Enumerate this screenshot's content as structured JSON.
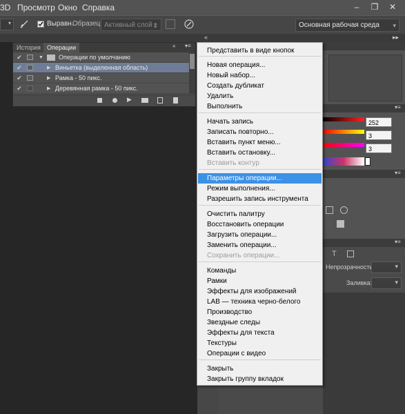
{
  "menubar": {
    "items": [
      "3D",
      "Просмотр",
      "Окно",
      "Справка"
    ]
  },
  "window_controls": [
    "–",
    "❐",
    "✕"
  ],
  "options_bar": {
    "align_label": "Выравн.",
    "sample_label": "Образец:",
    "sample_value": "Активный слой",
    "workspace_value": "Основная рабочая среда"
  },
  "panel": {
    "tabs": [
      "История",
      "Операции"
    ],
    "set_name": "Операции по умолчанию",
    "rows": [
      {
        "label": "Виньетка (выделенная область)",
        "selected": true
      },
      {
        "label": "Рамка - 50 пикс.",
        "selected": false
      },
      {
        "label": "Деревянная рамка - 50 пикс.",
        "selected": false
      }
    ],
    "collapse_glyph": "«",
    "menu_glyph": "▾≡"
  },
  "color_panel": {
    "values": [
      "252",
      "3",
      "3"
    ]
  },
  "layers_panel": {
    "opacity_label": "Непрозрачность:",
    "fill_label": "Заливка:"
  },
  "menu": {
    "groups": [
      [
        {
          "label": "Представить в виде кнопок"
        }
      ],
      [
        {
          "label": "Новая операция..."
        },
        {
          "label": "Новый набор..."
        },
        {
          "label": "Создать дубликат"
        },
        {
          "label": "Удалить"
        },
        {
          "label": "Выполнить"
        }
      ],
      [
        {
          "label": "Начать запись"
        },
        {
          "label": "Записать повторно..."
        },
        {
          "label": "Вставить пункт меню..."
        },
        {
          "label": "Вставить остановку..."
        },
        {
          "label": "Вставить контур",
          "disabled": true
        }
      ],
      [
        {
          "label": "Параметры операции...",
          "highlighted": true
        },
        {
          "label": "Режим выполнения..."
        },
        {
          "label": "Разрешить запись инструмента"
        }
      ],
      [
        {
          "label": "Очистить палитру"
        },
        {
          "label": "Восстановить операции"
        },
        {
          "label": "Загрузить операции..."
        },
        {
          "label": "Заменить операции..."
        },
        {
          "label": "Сохранить операции...",
          "disabled": true
        }
      ],
      [
        {
          "label": "Команды"
        },
        {
          "label": "Рамки"
        },
        {
          "label": "Эффекты для изображений"
        },
        {
          "label": "LAB — техника черно-белого"
        },
        {
          "label": "Производство"
        },
        {
          "label": "Звездные следы"
        },
        {
          "label": "Эффекты для текста"
        },
        {
          "label": "Текстуры"
        },
        {
          "label": "Операции с видео"
        }
      ],
      [
        {
          "label": "Закрыть"
        },
        {
          "label": "Закрыть группу вкладок"
        }
      ]
    ]
  },
  "colors": {
    "menu_highlight": "#3b91e6",
    "menu_bg": "#f0f0f0",
    "selected_row": "#6e7d95"
  }
}
